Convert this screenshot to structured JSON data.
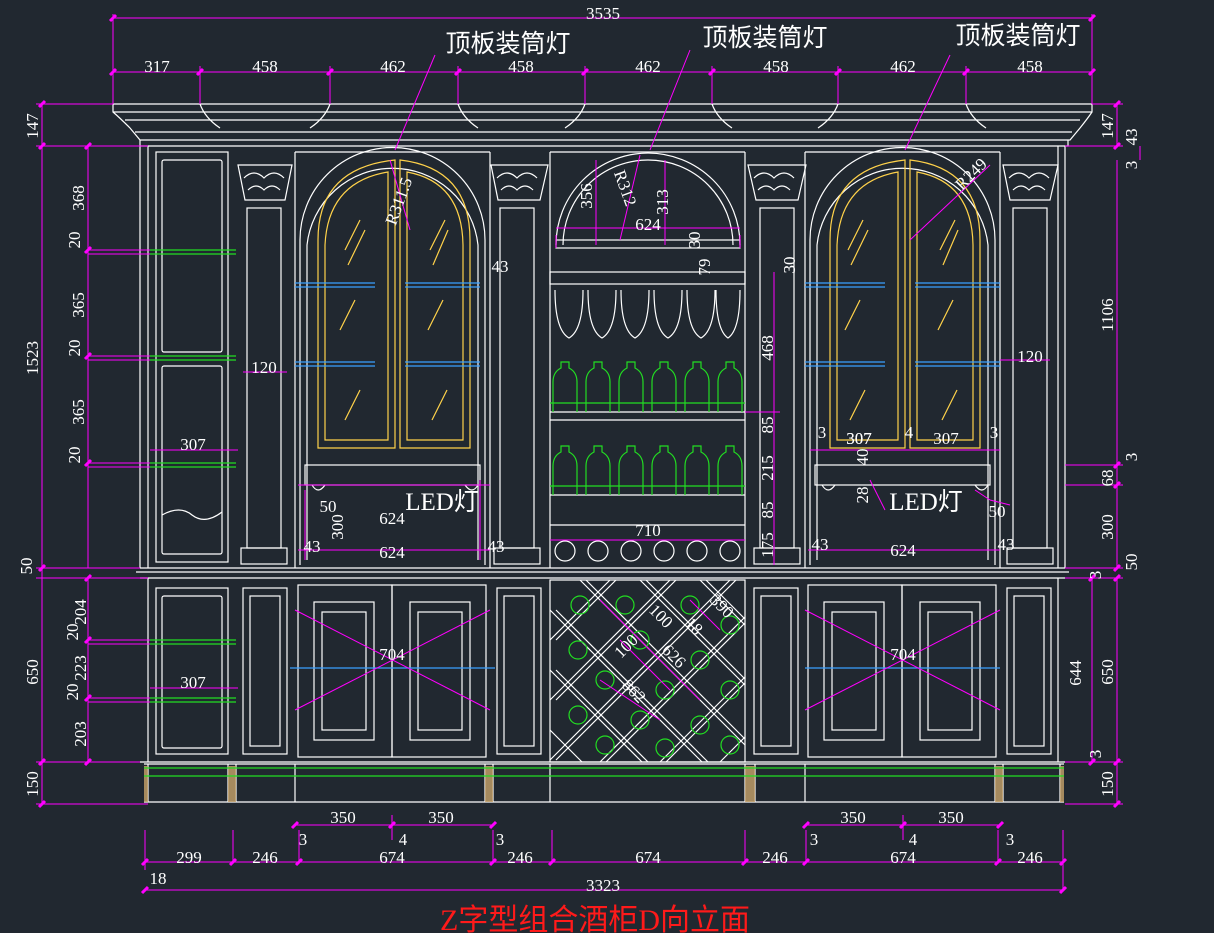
{
  "colors": {
    "background": "#212830",
    "linework": "#ffffff",
    "dimension": "#ff00ff",
    "glass": "#ffd24a",
    "shelf": "#3aa0ff",
    "bottle": "#22dd22",
    "title": "#ff1a1a"
  },
  "title": "Z字型组合酒柜D向立面",
  "labels": {
    "ceiling_light_1": "顶板装筒灯",
    "ceiling_light_2": "顶板装筒灯",
    "ceiling_light_3": "顶板装筒灯",
    "led_left": "LED灯",
    "led_right": "LED灯"
  },
  "dims": {
    "top_total": "3535",
    "top_1": "317",
    "top_2": "458",
    "top_3": "462",
    "top_4": "458",
    "top_5": "462",
    "top_6": "458",
    "top_7": "462",
    "top_8": "458",
    "left_147": "147",
    "left_368": "368",
    "left_20a": "20",
    "left_365a": "365",
    "left_20b": "20",
    "left_365b": "365",
    "left_20c": "20",
    "left_1523": "1523",
    "left_50": "50",
    "left_204": "204",
    "left_20d": "20",
    "left_223": "223",
    "left_20e": "20",
    "left_203": "203",
    "left_650": "650",
    "left_150": "150",
    "right_147": "147",
    "right_43": "43",
    "right_3a": "3",
    "right_1106": "1106",
    "right_3b": "3",
    "right_68": "68",
    "right_300": "300",
    "right_50": "50",
    "right_3c": "3",
    "right_644": "644",
    "right_650": "650",
    "right_3d": "3",
    "right_150": "150",
    "r311": "R311.5",
    "r312": "R312",
    "r249": "R249",
    "arch_356": "356",
    "arch_313": "313",
    "arch_624": "624",
    "arch_30a": "30",
    "arch_79": "79",
    "arch_30b": "30",
    "glass_468": "468",
    "rack_85a": "85",
    "rack_215": "215",
    "rack_85b": "85",
    "rack_175": "175",
    "rack_710": "710",
    "col_43a": "43",
    "col_120a": "120",
    "col_120b": "120",
    "panel_307a": "307",
    "panel_307b": "307",
    "panel_307c": "307",
    "led_50a": "50",
    "led_300": "300",
    "led_624a": "624",
    "led_624b": "624",
    "led_43a": "43",
    "led_43b": "43",
    "r_3a": "3",
    "r_307a": "307",
    "r_4": "4",
    "r_307b": "307",
    "r_3b": "3",
    "r_40": "40",
    "r_28": "28",
    "r_50": "50",
    "r_43a": "43",
    "r_624": "624",
    "r_43b": "43",
    "diag_390": "390",
    "diag_18": "18",
    "diag_100a": "100",
    "diag_100b": "100",
    "diag_626": "626",
    "diag_862": "862",
    "door_704a": "704",
    "door_704b": "704",
    "bot_350a": "350",
    "bot_350b": "350",
    "bot_350c": "350",
    "bot_350d": "350",
    "bot_3a": "3",
    "bot_4a": "4",
    "bot_3b": "3",
    "bot_3c": "3",
    "bot_4b": "4",
    "bot_3d": "3",
    "bot_299": "299",
    "bot_246a": "246",
    "bot_674a": "674",
    "bot_246b": "246",
    "bot_674b": "674",
    "bot_246c": "246",
    "bot_674c": "674",
    "bot_246d": "246",
    "bot_18": "18",
    "bot_total": "3323"
  }
}
